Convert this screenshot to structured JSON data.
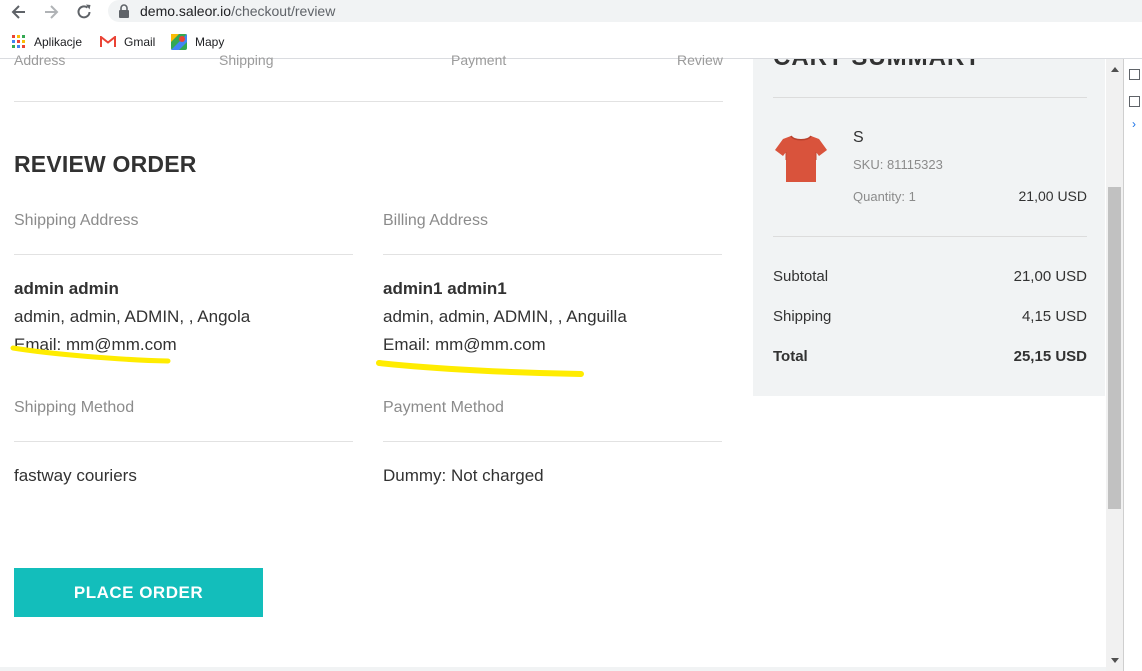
{
  "browser": {
    "url_host": "demo.saleor.io",
    "url_path": "/checkout/review",
    "bookmarks": [
      "Aplikacje",
      "Gmail",
      "Mapy"
    ]
  },
  "checkout": {
    "steps": [
      "Address",
      "Shipping",
      "Payment",
      "Review"
    ],
    "title": "REVIEW ORDER",
    "shipping_address": {
      "label": "Shipping Address",
      "name": "admin admin",
      "line": "admin, admin, ADMIN, , Angola",
      "email": "Email: mm@mm.com"
    },
    "billing_address": {
      "label": "Billing Address",
      "name": "admin1 admin1",
      "line": "admin, admin, ADMIN, , Anguilla",
      "email": "Email: mm@mm.com"
    },
    "shipping_method": {
      "label": "Shipping Method",
      "value": "fastway couriers"
    },
    "payment_method": {
      "label": "Payment Method",
      "value": "Dummy: Not charged"
    },
    "place_order_label": "PLACE ORDER"
  },
  "cart": {
    "title": "CART SUMMARY",
    "item": {
      "name": "S",
      "sku": "SKU: 81115323",
      "quantity": "Quantity: 1",
      "price": "21,00 USD"
    },
    "subtotal_label": "Subtotal",
    "subtotal_value": "21,00 USD",
    "shipping_label": "Shipping",
    "shipping_value": "4,15 USD",
    "total_label": "Total",
    "total_value": "25,15 USD"
  },
  "colors": {
    "accent": "#13bebb",
    "highlight": "#ffec00",
    "panel": "#f1f3f4",
    "tshirt": "#d9533c"
  }
}
